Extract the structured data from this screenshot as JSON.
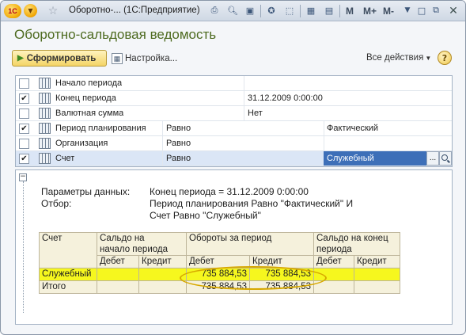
{
  "window": {
    "title": "Оборотно-... (1С:Предприятие)",
    "logo": "1С",
    "toolbar_letters": [
      "M",
      "M+",
      "M-"
    ]
  },
  "page": {
    "title": "Оборотно-сальдовая ведомость"
  },
  "toolbar": {
    "run_label": "Сформировать",
    "settings_label": "Настройка...",
    "all_actions_label": "Все действия",
    "help_label": "?"
  },
  "settings": {
    "rows": [
      {
        "checked": false,
        "name": "Начало периода",
        "condition": "",
        "value": ""
      },
      {
        "checked": true,
        "name": "Конец периода",
        "condition": "",
        "value": "31.12.2009 0:00:00"
      },
      {
        "checked": false,
        "name": "Валютная сумма",
        "condition": "",
        "value": "Нет"
      },
      {
        "checked": true,
        "name": "Период планирования",
        "condition": "Равно",
        "value": "Фактический"
      },
      {
        "checked": false,
        "name": "Организация",
        "condition": "Равно",
        "value": ""
      },
      {
        "checked": true,
        "name": "Счет",
        "condition": "Равно",
        "value": "Служебный"
      }
    ],
    "ellipsis": "..."
  },
  "report": {
    "params_label": "Параметры данных:",
    "params_value": "Конец периода = 31.12.2009 0:00:00",
    "filter_label": "Отбор:",
    "filter_line1": "Период планирования Равно \"Фактический\" И",
    "filter_line2": "Счет Равно \"Служебный\"",
    "table": {
      "col_account": "Счет",
      "col_opening_1": "Сальдо на",
      "col_opening_2": "начало периода",
      "col_turnover": "Обороты за период",
      "col_closing_1": "Сальдо на конец",
      "col_closing_2": "периода",
      "debit": "Дебет",
      "credit": "Кредит",
      "rows": [
        {
          "account": "Служебный",
          "open_debit": "",
          "open_credit": "",
          "turn_debit": "735 884,53",
          "turn_credit": "735 884,53",
          "close_debit": "",
          "close_credit": ""
        },
        {
          "account": "Итого",
          "open_debit": "",
          "open_credit": "",
          "turn_debit": "735 884,53",
          "turn_credit": "735 884,53",
          "close_debit": "",
          "close_credit": ""
        }
      ]
    }
  },
  "colors": {
    "title_green": "#4d6a1f",
    "highlight_yellow": "#f6f71e",
    "annotation_oval": "#d7a800"
  }
}
